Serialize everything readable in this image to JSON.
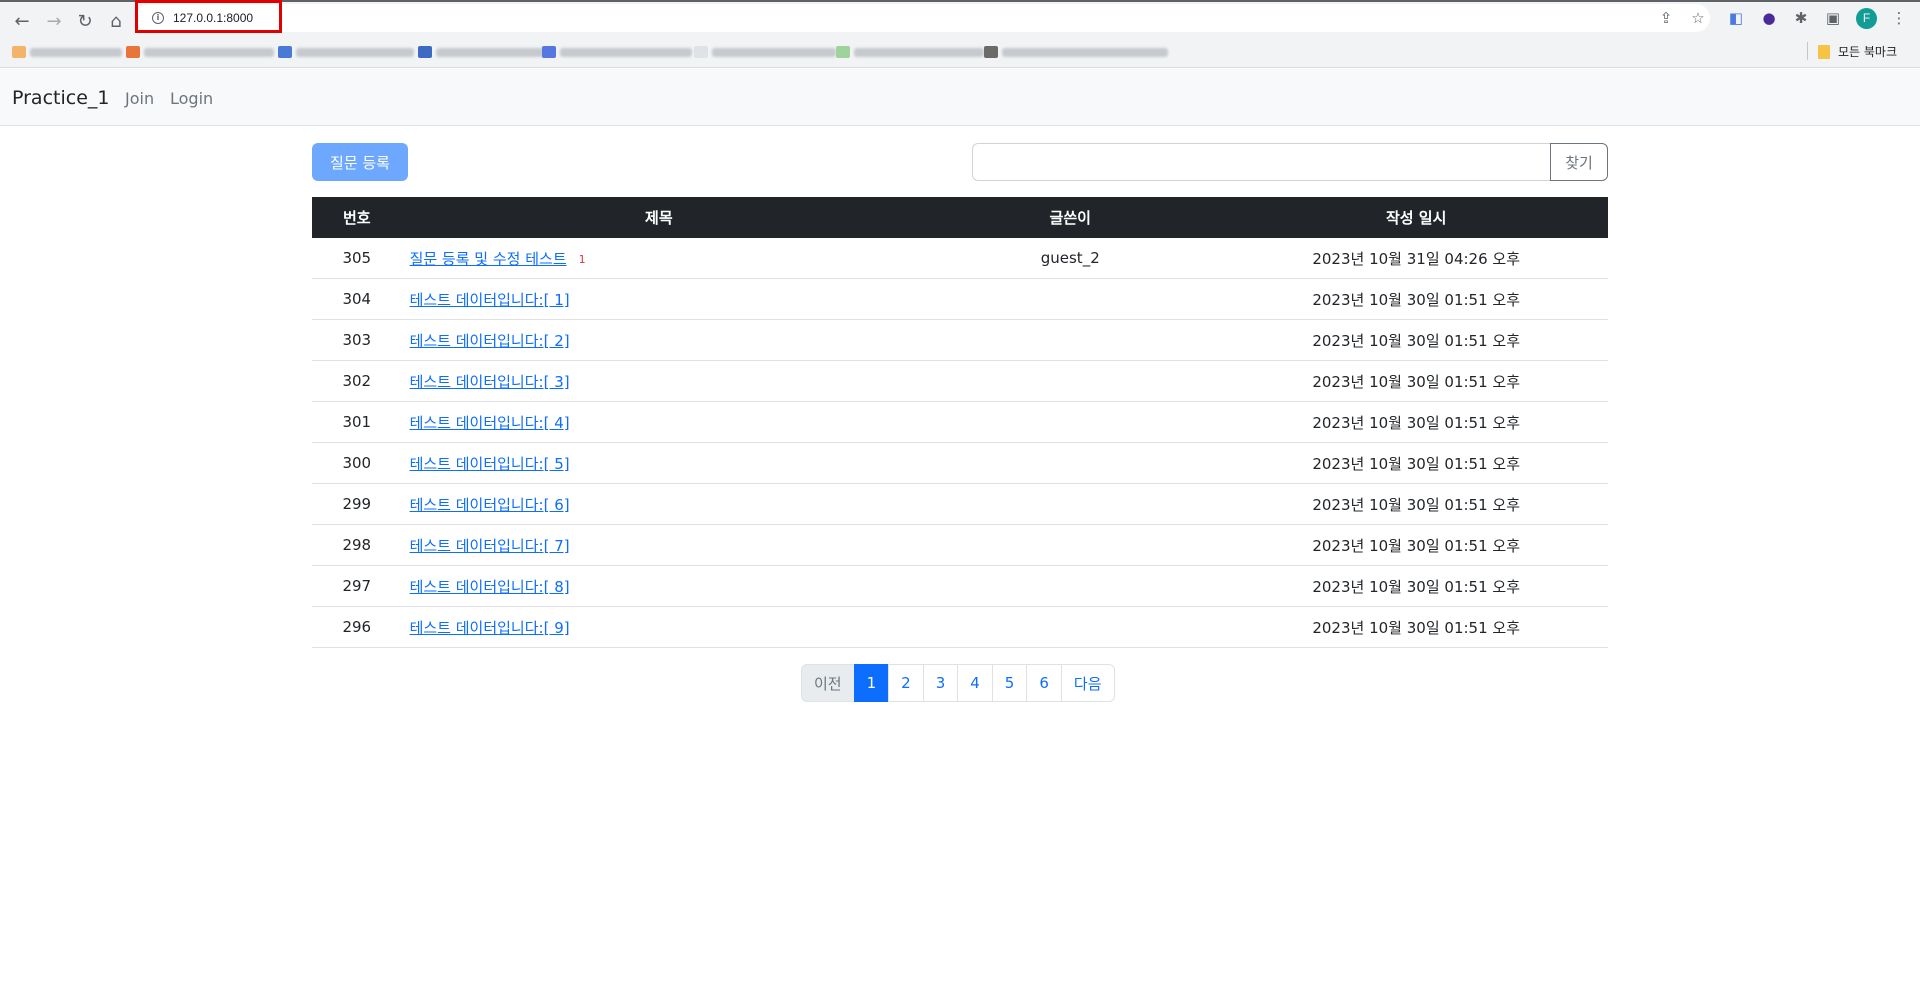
{
  "browser": {
    "url": "127.0.0.1:8000",
    "profile_initial": "F",
    "all_bookmarks_label": "모든 북마크"
  },
  "navbar": {
    "brand": "Practice_1",
    "links": [
      "Join",
      "Login"
    ]
  },
  "toolbar": {
    "create_label": "질문 등록",
    "search_placeholder": "",
    "search_label": "찾기"
  },
  "table": {
    "headers": [
      "번호",
      "제목",
      "글쓴이",
      "작성 일시"
    ],
    "rows": [
      {
        "num": "305",
        "title": "질문 등록 및 수정 테스트",
        "answers": "1",
        "author": "guest_2",
        "date": "2023년 10월 31일 04:26 오후"
      },
      {
        "num": "304",
        "title": "테스트 데이터입니다:[ 1]",
        "answers": "",
        "author": "",
        "date": "2023년 10월 30일 01:51 오후"
      },
      {
        "num": "303",
        "title": "테스트 데이터입니다:[ 2]",
        "answers": "",
        "author": "",
        "date": "2023년 10월 30일 01:51 오후"
      },
      {
        "num": "302",
        "title": "테스트 데이터입니다:[ 3]",
        "answers": "",
        "author": "",
        "date": "2023년 10월 30일 01:51 오후"
      },
      {
        "num": "301",
        "title": "테스트 데이터입니다:[ 4]",
        "answers": "",
        "author": "",
        "date": "2023년 10월 30일 01:51 오후"
      },
      {
        "num": "300",
        "title": "테스트 데이터입니다:[ 5]",
        "answers": "",
        "author": "",
        "date": "2023년 10월 30일 01:51 오후"
      },
      {
        "num": "299",
        "title": "테스트 데이터입니다:[ 6]",
        "answers": "",
        "author": "",
        "date": "2023년 10월 30일 01:51 오후"
      },
      {
        "num": "298",
        "title": "테스트 데이터입니다:[ 7]",
        "answers": "",
        "author": "",
        "date": "2023년 10월 30일 01:51 오후"
      },
      {
        "num": "297",
        "title": "테스트 데이터입니다:[ 8]",
        "answers": "",
        "author": "",
        "date": "2023년 10월 30일 01:51 오후"
      },
      {
        "num": "296",
        "title": "테스트 데이터입니다:[ 9]",
        "answers": "",
        "author": "",
        "date": "2023년 10월 30일 01:51 오후"
      }
    ]
  },
  "pagination": {
    "prev_label": "이전",
    "pages": [
      "1",
      "2",
      "3",
      "4",
      "5",
      "6"
    ],
    "active_page": "1",
    "next_label": "다음"
  }
}
